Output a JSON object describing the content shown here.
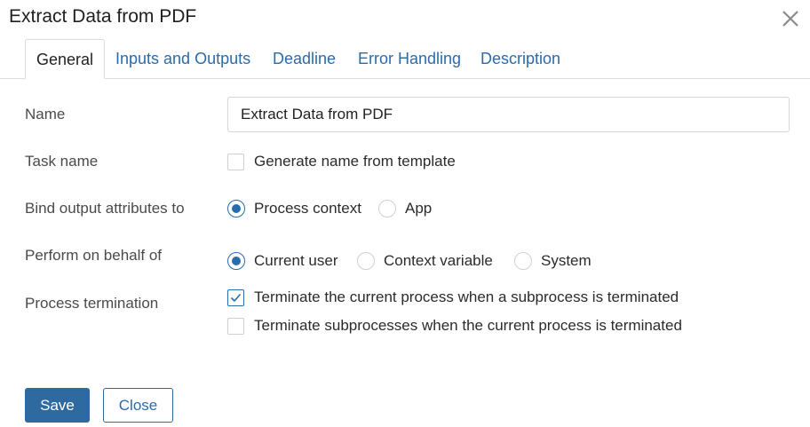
{
  "dialog": {
    "title": "Extract Data from PDF",
    "close_icon": "close-icon"
  },
  "tabs": [
    {
      "label": "General",
      "active": true
    },
    {
      "label": "Inputs and Outputs",
      "active": false
    },
    {
      "label": "Deadline",
      "active": false
    },
    {
      "label": "Error Handling",
      "active": false
    },
    {
      "label": "Description",
      "active": false
    }
  ],
  "form": {
    "name": {
      "label": "Name",
      "value": "Extract Data from PDF"
    },
    "task_name": {
      "label": "Task name",
      "checkbox_label": "Generate name from template",
      "checked": false
    },
    "bind_output": {
      "label": "Bind output attributes to",
      "options": [
        "Process context",
        "App"
      ],
      "selected": "Process context"
    },
    "perform_on_behalf": {
      "label": "Perform on behalf of",
      "options": [
        "Current user",
        "Context variable",
        "System"
      ],
      "selected": "Current user"
    },
    "process_termination": {
      "label": "Process termination",
      "options": [
        {
          "label": "Terminate the current process when a subprocess is terminated",
          "checked": true
        },
        {
          "label": "Terminate subprocesses when the current process is terminated",
          "checked": false
        }
      ]
    }
  },
  "buttons": {
    "save": "Save",
    "close": "Close"
  },
  "colors": {
    "accent": "#2a6ba9",
    "primary_button": "#2e6aa0",
    "border": "#dcdcdc"
  }
}
